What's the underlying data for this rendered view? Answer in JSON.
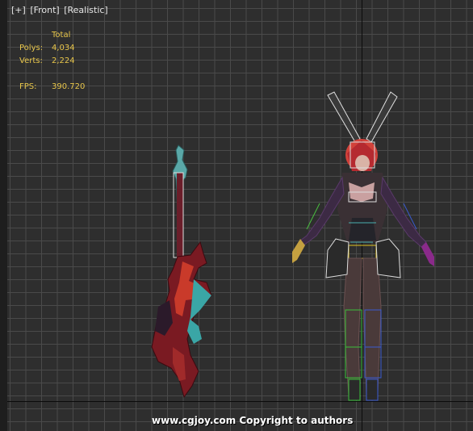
{
  "viewport": {
    "label_parts": [
      "[+]",
      "[Front]",
      "[Realistic]"
    ],
    "view_name": "Front",
    "shading": "Realistic"
  },
  "stats": {
    "header": "Total",
    "polys_label": "Polys:",
    "polys_value": "4,034",
    "verts_label": "Verts:",
    "verts_value": "2,224",
    "fps_label": "FPS:",
    "fps_value": "390.720"
  },
  "watermark": "www.cgjoy.com Copyright to authors",
  "colors": {
    "grid": "#4a4a4a",
    "background": "#2e2e2e",
    "stats_text": "#e8c64a",
    "axis": "#0c0c0c"
  }
}
